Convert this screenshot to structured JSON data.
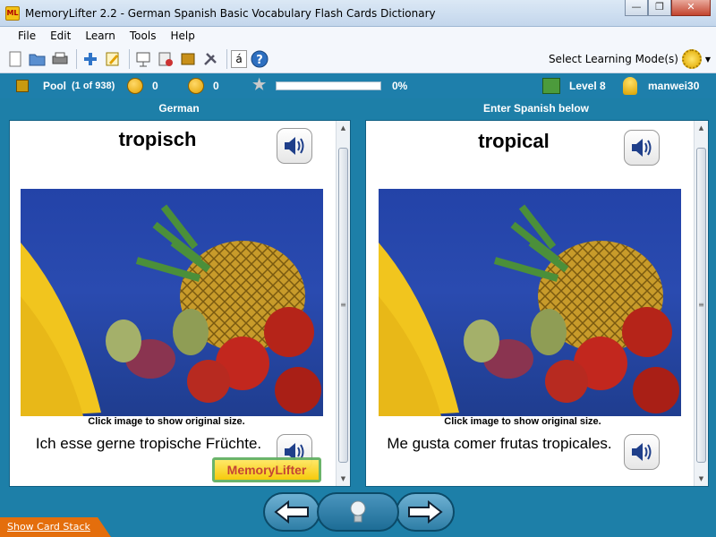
{
  "window": {
    "app_icon_text": "ML",
    "title": "MemoryLifter 2.2 - German Spanish Basic Vocabulary Flash Cards Dictionary",
    "controls": {
      "minimize": "—",
      "maximize": "❐",
      "close": "✕"
    }
  },
  "menu": [
    "File",
    "Edit",
    "Learn",
    "Tools",
    "Help"
  ],
  "toolbar": {
    "icons": [
      "new-icon",
      "open-icon",
      "print-icon",
      "add-icon",
      "edit-icon",
      "presentation-icon",
      "print-cards-icon",
      "card-stack-icon",
      "settings-icon",
      "character-icon",
      "help-icon"
    ],
    "char_button": "á",
    "help_glyph": "?",
    "learning_mode_label": "Select Learning Mode(s)"
  },
  "status": {
    "pool_label": "Pool",
    "pool_count": "(1 of 938)",
    "right_count": "0",
    "wrong_count": "0",
    "progress_percent": 0,
    "progress_text": "0%",
    "level": "Level 8",
    "user": "manwei30"
  },
  "question": {
    "header": "German",
    "word": "tropisch",
    "image_hint": "Click image to show original size.",
    "sentence": "Ich esse gerne tropische Früchte."
  },
  "answer": {
    "header": "Enter Spanish below",
    "word": "tropical",
    "image_hint": "Click image to show original size.",
    "sentence": "Me gusta comer frutas tropicales."
  },
  "watermark": "MemoryLifter",
  "bottom": {
    "show_card_stack": "Show Card Stack"
  },
  "colors": {
    "app_background": "#1d7fa8",
    "card_background": "#ffffff",
    "show_stack": "#e46e0c"
  }
}
